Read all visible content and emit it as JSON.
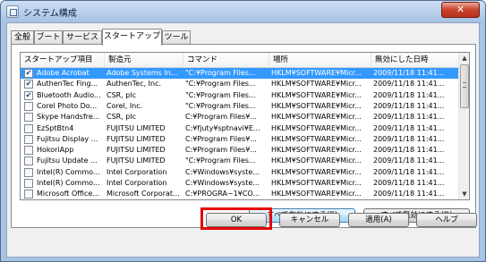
{
  "window": {
    "title": "システム構成",
    "close_label": "✕"
  },
  "tabs": [
    {
      "label": "全般",
      "active": false
    },
    {
      "label": "ブート",
      "active": false
    },
    {
      "label": "サービス",
      "active": false
    },
    {
      "label": "スタートアップ",
      "active": true
    },
    {
      "label": "ツール",
      "active": false
    }
  ],
  "listview": {
    "columns": [
      "スタートアップ項目",
      "製造元",
      "コマンド",
      "場所",
      "無効にした日時"
    ],
    "rows": [
      {
        "checked": true,
        "selected": true,
        "cells": [
          "Adobe Acrobat",
          "Adobe Systems In...",
          "\"C:¥Program Files...",
          "HKLM¥SOFTWARE¥Micr...",
          "2009/11/18 11:41..."
        ]
      },
      {
        "checked": true,
        "selected": false,
        "cells": [
          "AuthenTec Fing...",
          "AuthenTec, Inc.",
          "\"C:¥Program Files...",
          "HKLM¥SOFTWARE¥Micr...",
          "2009/11/18 11:41..."
        ]
      },
      {
        "checked": true,
        "selected": false,
        "cells": [
          "Bluetooth Audio...",
          "CSR, plc",
          "\"C:¥Program Files...",
          "HKLM¥SOFTWARE¥Micr...",
          "2009/11/18 11:41..."
        ]
      },
      {
        "checked": false,
        "selected": false,
        "cells": [
          "Corel Photo Do...",
          "Corel, Inc.",
          "\"C:¥Program Files...",
          "HKLM¥SOFTWARE¥Micr...",
          "2009/11/18 11:41..."
        ]
      },
      {
        "checked": false,
        "selected": false,
        "cells": [
          "Skype Handsfre...",
          "CSR, plc",
          "C:¥Program Files¥...",
          "HKLM¥SOFTWARE¥Micr...",
          "2009/11/18 11:41..."
        ]
      },
      {
        "checked": false,
        "selected": false,
        "cells": [
          "EzSptBtn4",
          "FUJITSU LIMITED",
          "C:¥fjuty¥sptnavi¥E...",
          "HKLM¥SOFTWARE¥Micr...",
          "2009/11/18 11:41..."
        ]
      },
      {
        "checked": false,
        "selected": false,
        "cells": [
          "Fujitsu Display ...",
          "FUJITSU LIMITED",
          "C:¥Program Files¥...",
          "HKLM¥SOFTWARE¥Micr...",
          "2009/11/18 11:41..."
        ]
      },
      {
        "checked": false,
        "selected": false,
        "cells": [
          "HokoriApp",
          "FUJITSU LIMITED",
          "C:¥Program Files¥...",
          "HKLM¥SOFTWARE¥Micr...",
          "2009/11/18 11:41..."
        ]
      },
      {
        "checked": false,
        "selected": false,
        "cells": [
          "Fujitsu Update ...",
          "FUJITSU LIMITED",
          "\"C:¥Program Files...",
          "HKLM¥SOFTWARE¥Micr...",
          "2009/11/18 11:41..."
        ]
      },
      {
        "checked": false,
        "selected": false,
        "cells": [
          "Intel(R) Commo...",
          "Intel Corporation",
          "C:¥Windows¥syste...",
          "HKLM¥SOFTWARE¥Micr...",
          "2009/11/18 11:41..."
        ]
      },
      {
        "checked": false,
        "selected": false,
        "cells": [
          "Intel(R) Commo...",
          "Intel Corporation",
          "C:¥Windows¥syste...",
          "HKLM¥SOFTWARE¥Micr...",
          "2009/11/18 11:41..."
        ]
      },
      {
        "checked": false,
        "selected": false,
        "cells": [
          "Microsoft Office...",
          "Microsoft Corporat...",
          "C:¥PROGRA~1¥CO...",
          "HKLM¥SOFTWARE¥Micr...",
          "2009/11/18 11:41..."
        ]
      }
    ]
  },
  "actions": {
    "enable_all": "すべて有効にする(E)",
    "disable_all": "すべて無効にする(D)"
  },
  "footer": {
    "ok": "OK",
    "cancel": "キャンセル",
    "apply": "適用(A)",
    "help": "ヘルプ"
  },
  "colors": {
    "selection": "#3399ff",
    "highlight_frame": "#e60000"
  }
}
